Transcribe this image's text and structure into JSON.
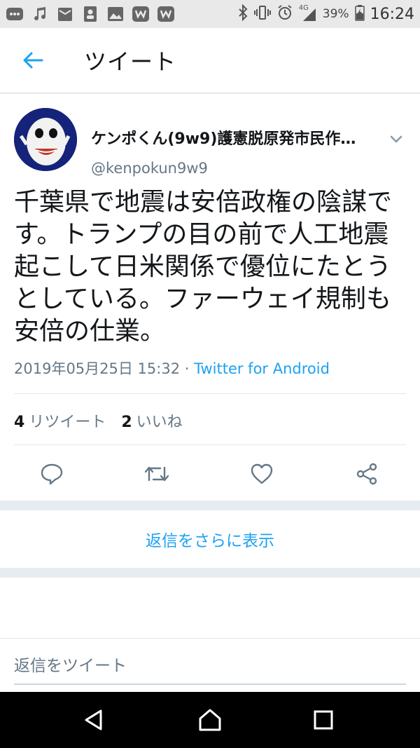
{
  "status_bar": {
    "network": "4G",
    "battery": "39%",
    "time": "16:24",
    "left_icons": [
      "messenger-icon",
      "music-icon",
      "mail-icon",
      "contacts-icon",
      "gallery-icon",
      "metro-icon",
      "metro-icon"
    ],
    "right_icons": [
      "bluetooth-icon",
      "vibrate-icon",
      "alarm-icon",
      "signal-icon",
      "battery-icon"
    ]
  },
  "header": {
    "title": "ツイート",
    "back_icon": "arrow-left-icon"
  },
  "tweet": {
    "display_name": "ケンポくん(9w9)護憲脱原発市民作…",
    "handle": "@kenpokun9w9",
    "text": "千葉県で地震は安倍政権の陰謀です。トランプの目の前で人工地震起こして日米関係で優位にたとうとしている。ファーウェイ規制も安倍の仕業。",
    "date": "2019年05月25日 15:32",
    "separator": " · ",
    "source": "Twitter for Android",
    "retweet_count": "4",
    "retweet_label": "リツイート",
    "like_count": "2",
    "like_label": "いいね",
    "actions": [
      "reply-icon",
      "retweet-icon",
      "like-icon",
      "share-icon"
    ]
  },
  "more_replies": "返信をさらに表示",
  "reply": {
    "placeholder": "返信をツイート"
  },
  "colors": {
    "accent": "#1da1f2",
    "secondary_text": "#657786",
    "divider": "#e1e8ed",
    "band": "#e6ecf0"
  },
  "nav_bar": [
    "back-triangle-icon",
    "home-circle-icon",
    "recents-square-icon"
  ]
}
